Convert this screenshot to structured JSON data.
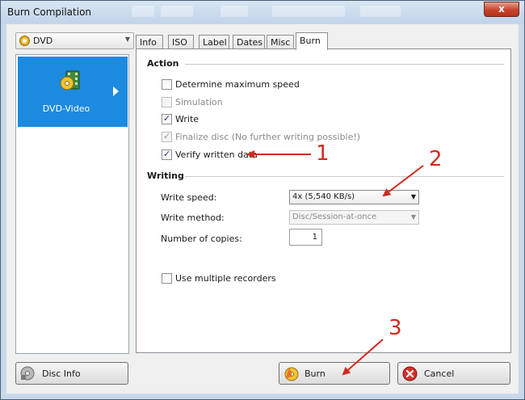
{
  "window": {
    "title": "Burn Compilation",
    "close_label": "x"
  },
  "left": {
    "disc_type": "DVD",
    "compilation_label": "DVD-Video",
    "disc_info_button": "Disc Info"
  },
  "tabs": [
    "Info",
    "ISO",
    "Label",
    "Dates",
    "Misc",
    "Burn"
  ],
  "active_tab": "Burn",
  "action": {
    "title": "Action",
    "options": [
      {
        "label": "Determine maximum speed",
        "checked": false,
        "enabled": true
      },
      {
        "label": "Simulation",
        "checked": false,
        "enabled": false
      },
      {
        "label": "Write",
        "checked": true,
        "enabled": true
      },
      {
        "label": "Finalize disc (No further writing possible!)",
        "checked": true,
        "enabled": false
      },
      {
        "label": "Verify written data",
        "checked": true,
        "enabled": true
      }
    ]
  },
  "writing": {
    "title": "Writing",
    "write_speed_label": "Write speed:",
    "write_speed_value": "4x (5,540 KB/s)",
    "write_method_label": "Write method:",
    "write_method_value": "Disc/Session-at-once",
    "copies_label": "Number of copies:",
    "copies_value": "1",
    "multiple_recorders_label": "Use multiple recorders"
  },
  "buttons": {
    "burn": "Burn",
    "cancel": "Cancel"
  },
  "annotations": [
    "1",
    "2",
    "3"
  ],
  "colors": {
    "accent": "#1c8adf",
    "annotation": "#d42a20"
  }
}
